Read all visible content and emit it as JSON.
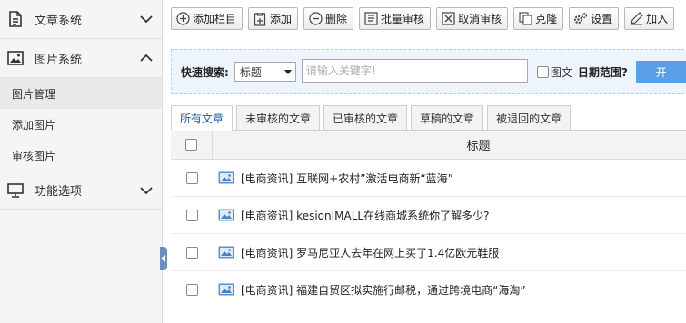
{
  "sidebar": {
    "groups": [
      {
        "label": "文章系统",
        "icon": "document-icon",
        "expanded": false
      },
      {
        "label": "图片系统",
        "icon": "picture-icon",
        "expanded": true,
        "items": [
          {
            "label": "图片管理",
            "active": true
          },
          {
            "label": "添加图片",
            "active": false
          },
          {
            "label": "审核图片",
            "active": false
          }
        ]
      },
      {
        "label": "功能选项",
        "icon": "monitor-icon",
        "expanded": false
      }
    ]
  },
  "toolbar": {
    "buttons": [
      {
        "label": "添加栏目",
        "icon": "plus-circle-icon"
      },
      {
        "label": "添加",
        "icon": "add-file-icon"
      },
      {
        "label": "删除",
        "icon": "minus-circle-icon"
      },
      {
        "label": "批量审核",
        "icon": "batch-review-icon"
      },
      {
        "label": "取消审核",
        "icon": "cancel-review-icon"
      },
      {
        "label": "克隆",
        "icon": "clone-icon"
      },
      {
        "label": "设置",
        "icon": "gear-icon"
      },
      {
        "label": "加入",
        "icon": "pencil-icon"
      }
    ]
  },
  "search": {
    "label": "快速搜索:",
    "field_value": "标题",
    "placeholder": "请输入关键字!",
    "image_text_label": "图文",
    "date_range_label": "日期范围?",
    "start_label": "开"
  },
  "tabs": [
    {
      "label": "所有文章",
      "active": true
    },
    {
      "label": "未审核的文章",
      "active": false
    },
    {
      "label": "已审核的文章",
      "active": false
    },
    {
      "label": "草稿的文章",
      "active": false
    },
    {
      "label": "被退回的文章",
      "active": false
    }
  ],
  "table": {
    "header_title": "标题",
    "rows": [
      "[电商资讯] 互联网+农村”激活电商新“蓝海”",
      "[电商资讯] kesionIMALL在线商城系统你了解多少?",
      "[电商资讯] 罗马尼亚人去年在网上买了1.4亿欧元鞋服",
      "[电商资讯] 福建自贸区拟实施行邮税，通过跨境电商“海淘”"
    ]
  },
  "colors": {
    "accent_blue": "#5aa0e8",
    "search_bg": "#eef4fb",
    "sidebar_bg": "#f5f5f5",
    "tab_active_text": "#1b5fa8"
  }
}
